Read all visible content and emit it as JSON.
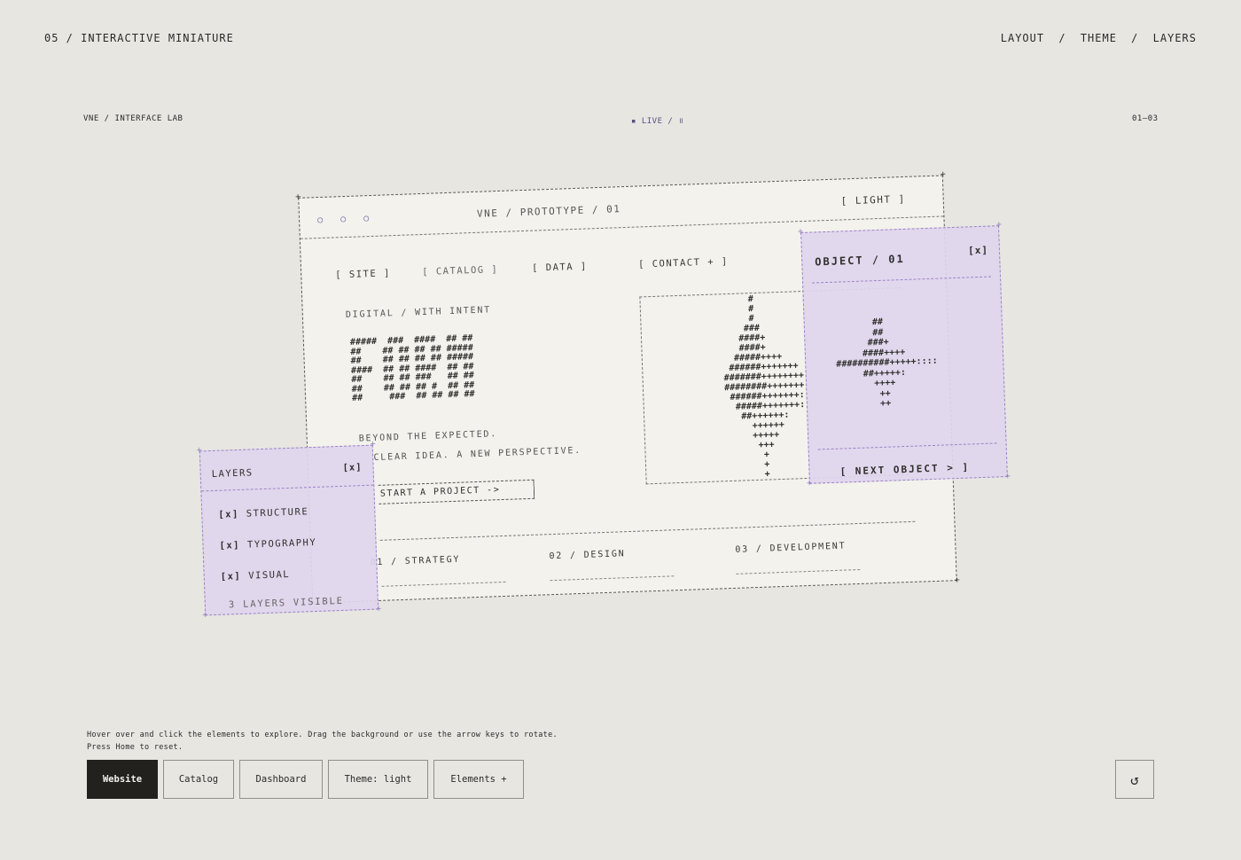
{
  "header": {
    "section_label": "05 / INTERACTIVE MINIATURE",
    "nav_right": [
      "LAYOUT",
      "/",
      "THEME",
      "/",
      "LAYERS"
    ]
  },
  "meta": {
    "left": "VNE / INTERFACE LAB",
    "center": "▪ LIVE / ॥",
    "right": "01—03"
  },
  "card": {
    "dots": "○ ○ ○",
    "title": "VNE / PROTOTYPE / 01",
    "theme_toggle": "[ LIGHT ]",
    "nav": [
      "[ SITE ]",
      "[ CATALOG ]",
      "[ DATA ]",
      "[ CONTACT + ]"
    ],
    "eyebrow": "DIGITAL / WITH INTENT",
    "ascii_logo": "#####  ###  ####  ## ##\n##    ## ## ## ## #####\n##    ## ## ## ## #####\n####  ## ## ####  ## ##\n##    ## ## ###   ## ##\n##    ## ## ## #  ## ##\n##     ###  ## ## ## ##",
    "tagline_1": "BEYOND THE EXPECTED.",
    "tagline_2": "CLEAR IDEA. A NEW PERSPECTIVE.",
    "cta": "START A PROJECT ->",
    "ascii_visual": "         #\n         #\n         #\n        ###\n       ####+\n       ####+\n      #####++++\n     ######+++++++\n    #######++++++++\n    ########+++++++\n     ######+++++++:\n      #####+++++++:\n       ##++++++:\n         ++++++\n         +++++\n          +++\n           +\n           +\n           +",
    "services": [
      "01 / STRATEGY",
      "02 / DESIGN",
      "03 / DEVELOPMENT"
    ]
  },
  "layers_panel": {
    "title": "LAYERS",
    "close": "[x]",
    "items": [
      {
        "check": "[x]",
        "label": "STRUCTURE"
      },
      {
        "check": "[x]",
        "label": "TYPOGRAPHY"
      },
      {
        "check": "[x]",
        "label": "VISUAL"
      }
    ],
    "count": "3 LAYERS VISIBLE"
  },
  "object_panel": {
    "title": "OBJECT / 01",
    "close": "[x]",
    "ascii": "       ##\n       ##\n      ###+\n     ####++++\n##########+++++::::\n     ##+++++:\n       ++++\n        ++\n        ++",
    "next": "[ NEXT OBJECT > ]"
  },
  "hint": {
    "line1": "Hover over and click the elements to explore. Drag the background or use the arrow keys to rotate.",
    "line2": "Press Home to reset."
  },
  "toolbar": {
    "buttons": [
      "Website",
      "Catalog",
      "Dashboard",
      "Theme: light",
      "Elements +"
    ],
    "reset_glyph": "↺"
  }
}
